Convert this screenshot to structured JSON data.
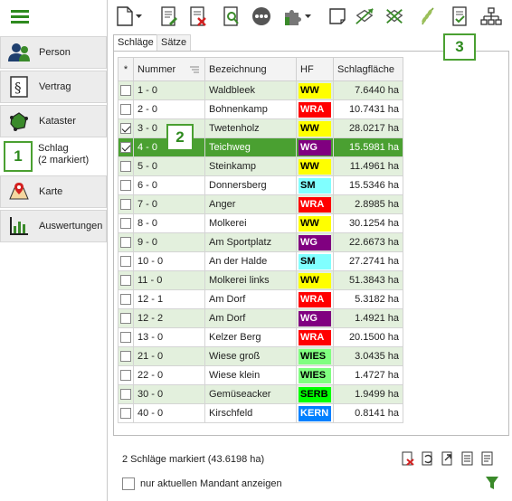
{
  "sidebar": {
    "items": [
      {
        "label": "Person",
        "icon": "person-icon"
      },
      {
        "label": "Vertrag",
        "icon": "contract-icon"
      },
      {
        "label": "Kataster",
        "icon": "cadastre-icon"
      },
      {
        "label": "Schlag",
        "sublabel": "(2 markiert)",
        "icon": "none"
      },
      {
        "label": "Karte",
        "icon": "map-pin-icon"
      },
      {
        "label": "Auswertungen",
        "icon": "bar-chart-icon"
      }
    ]
  },
  "tabs": [
    {
      "label": "Schläge",
      "active": true
    },
    {
      "label": "Sätze",
      "active": false
    }
  ],
  "grid": {
    "columns": [
      "*",
      "Nummer",
      "Bezeichnung",
      "HF",
      "Schlagfläche"
    ],
    "rows": [
      {
        "checked": false,
        "nummer": "1 - 0",
        "bezeichnung": "Waldbleek",
        "hf": "WW",
        "hf_bg": "#ffff00",
        "hf_fg": "#000000",
        "flaeche": "7.6440 ha"
      },
      {
        "checked": false,
        "nummer": "2 - 0",
        "bezeichnung": "Bohnenkamp",
        "hf": "WRA",
        "hf_bg": "#ff0000",
        "hf_fg": "#ffffff",
        "flaeche": "10.7431 ha"
      },
      {
        "checked": true,
        "nummer": "3 - 0",
        "bezeichnung": "Twetenholz",
        "hf": "WW",
        "hf_bg": "#ffff00",
        "hf_fg": "#000000",
        "flaeche": "28.0217 ha"
      },
      {
        "checked": true,
        "nummer": "4 - 0",
        "bezeichnung": "Teichweg",
        "hf": "WG",
        "hf_bg": "#800080",
        "hf_fg": "#ffffff",
        "flaeche": "15.5981 ha",
        "selected": true
      },
      {
        "checked": false,
        "nummer": "5 - 0",
        "bezeichnung": "Steinkamp",
        "hf": "WW",
        "hf_bg": "#ffff00",
        "hf_fg": "#000000",
        "flaeche": "11.4961 ha"
      },
      {
        "checked": false,
        "nummer": "6 - 0",
        "bezeichnung": "Donnersberg",
        "hf": "SM",
        "hf_bg": "#80ffff",
        "hf_fg": "#000000",
        "flaeche": "15.5346 ha"
      },
      {
        "checked": false,
        "nummer": "7 - 0",
        "bezeichnung": "Anger",
        "hf": "WRA",
        "hf_bg": "#ff0000",
        "hf_fg": "#ffffff",
        "flaeche": "2.8985 ha"
      },
      {
        "checked": false,
        "nummer": "8 - 0",
        "bezeichnung": "Molkerei",
        "hf": "WW",
        "hf_bg": "#ffff00",
        "hf_fg": "#000000",
        "flaeche": "30.1254 ha"
      },
      {
        "checked": false,
        "nummer": "9 - 0",
        "bezeichnung": "Am Sportplatz",
        "hf": "WG",
        "hf_bg": "#800080",
        "hf_fg": "#ffffff",
        "flaeche": "22.6673 ha"
      },
      {
        "checked": false,
        "nummer": "10 - 0",
        "bezeichnung": "An der Halde",
        "hf": "SM",
        "hf_bg": "#80ffff",
        "hf_fg": "#000000",
        "flaeche": "27.2741 ha"
      },
      {
        "checked": false,
        "nummer": "11 - 0",
        "bezeichnung": "Molkerei links",
        "hf": "WW",
        "hf_bg": "#ffff00",
        "hf_fg": "#000000",
        "flaeche": "51.3843 ha"
      },
      {
        "checked": false,
        "nummer": "12 - 1",
        "bezeichnung": "Am Dorf",
        "hf": "WRA",
        "hf_bg": "#ff0000",
        "hf_fg": "#ffffff",
        "flaeche": "5.3182 ha"
      },
      {
        "checked": false,
        "nummer": "12 - 2",
        "bezeichnung": "Am Dorf",
        "hf": "WG",
        "hf_bg": "#800080",
        "hf_fg": "#ffffff",
        "flaeche": "1.4921 ha"
      },
      {
        "checked": false,
        "nummer": "13 - 0",
        "bezeichnung": "Kelzer Berg",
        "hf": "WRA",
        "hf_bg": "#ff0000",
        "hf_fg": "#ffffff",
        "flaeche": "20.1500 ha"
      },
      {
        "checked": false,
        "nummer": "21 - 0",
        "bezeichnung": "Wiese groß",
        "hf": "WIES",
        "hf_bg": "#80ff80",
        "hf_fg": "#000000",
        "flaeche": "3.0435 ha"
      },
      {
        "checked": false,
        "nummer": "22 - 0",
        "bezeichnung": "Wiese klein",
        "hf": "WIES",
        "hf_bg": "#80ff80",
        "hf_fg": "#000000",
        "flaeche": "1.4727 ha"
      },
      {
        "checked": false,
        "nummer": "30 - 0",
        "bezeichnung": "Gemüseacker",
        "hf": "SERB",
        "hf_bg": "#00ff00",
        "hf_fg": "#000000",
        "flaeche": "1.9499 ha"
      },
      {
        "checked": false,
        "nummer": "40 - 0",
        "bezeichnung": "Kirschfeld",
        "hf": "KERN",
        "hf_bg": "#0080ff",
        "hf_fg": "#ffffff",
        "flaeche": "0.8141 ha"
      }
    ]
  },
  "footer": {
    "status": "2 Schläge markiert (43.6198 ha)",
    "checkbox_label": "nur aktuellen Mandant anzeigen"
  },
  "markers": [
    "1",
    "2",
    "3"
  ],
  "colors": {
    "accent": "#4aa031",
    "row_alt": "#e3f0dd",
    "selected_row": "#4aa031"
  }
}
